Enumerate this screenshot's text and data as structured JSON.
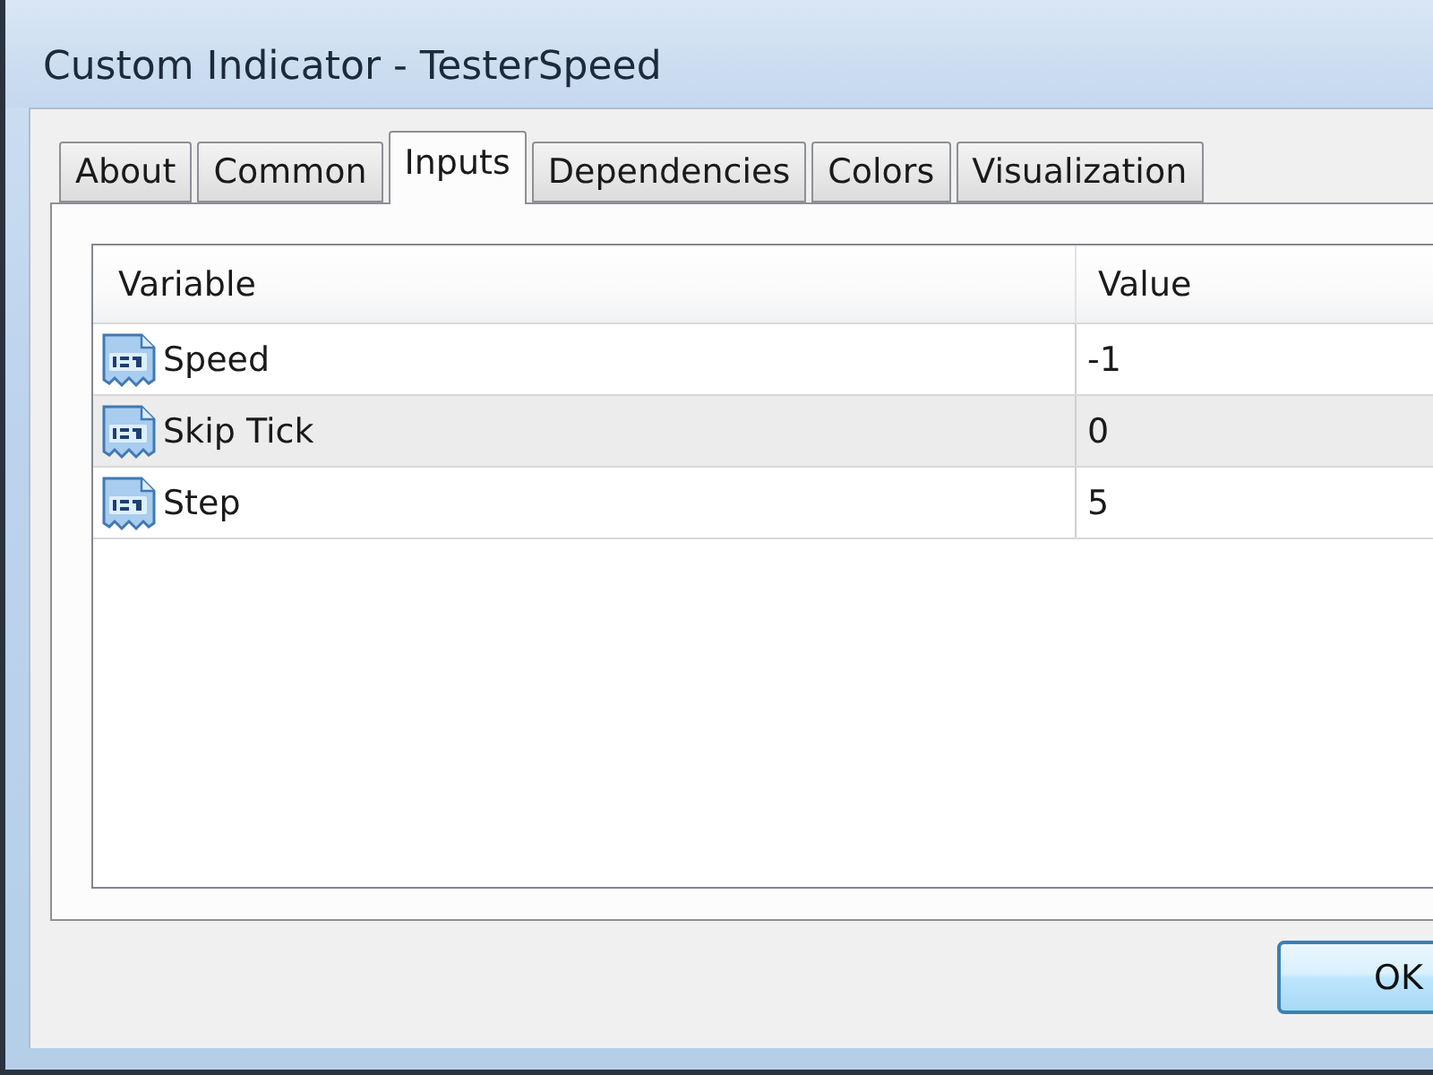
{
  "window": {
    "title": "Custom Indicator - TesterSpeed"
  },
  "tabs": [
    {
      "label": "About",
      "selected": false
    },
    {
      "label": "Common",
      "selected": false
    },
    {
      "label": "Inputs",
      "selected": true
    },
    {
      "label": "Dependencies",
      "selected": false
    },
    {
      "label": "Colors",
      "selected": false
    },
    {
      "label": "Visualization",
      "selected": false
    }
  ],
  "table": {
    "columns": [
      "Variable",
      "Value"
    ],
    "rows": [
      {
        "variable": "Speed",
        "value": "-1"
      },
      {
        "variable": "Skip Tick",
        "value": "0"
      },
      {
        "variable": "Step",
        "value": "5"
      }
    ]
  },
  "buttons": [
    "OK"
  ]
}
